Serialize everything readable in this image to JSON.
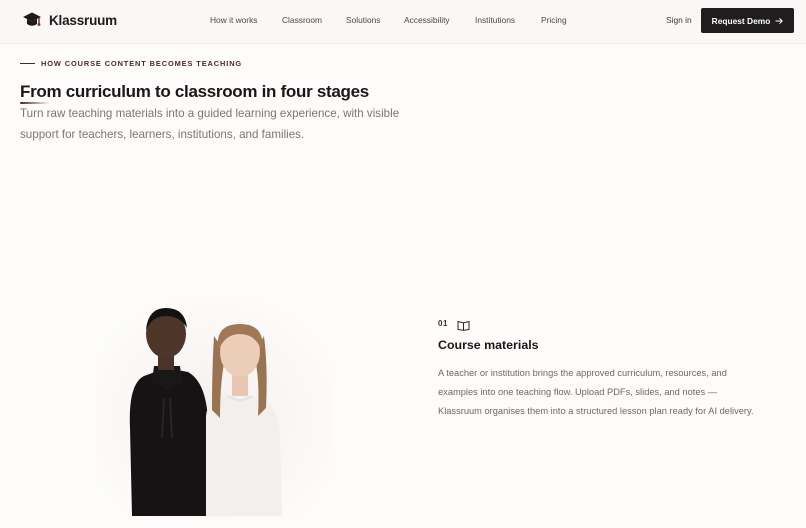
{
  "header": {
    "brand": "Klassruum",
    "nav": [
      "How it works",
      "Classroom",
      "Solutions",
      "Accessibility",
      "Institutions",
      "Pricing"
    ],
    "signin": "Sign in",
    "cta": "Request Demo",
    "cta_icon": "arrow-right-icon"
  },
  "hero": {
    "eyebrow": "HOW COURSE CONTENT BECOMES TEACHING",
    "title": "From curriculum to classroom in four stages",
    "subtitle": "Turn raw teaching materials into a guided learning experience, with visible support for teachers, learners, institutions, and families."
  },
  "step": {
    "number": "01",
    "icon": "book-icon",
    "title": "Course materials",
    "description": "A teacher or institution brings the approved curriculum, resources, and examples into one teaching flow. Upload PDFs, slides, and notes — Klassruum organises them into a structured lesson plan ready for AI delivery."
  },
  "colors": {
    "accent": "#5a1e2a",
    "button_bg": "#1f1d1e",
    "background": "#fdfcfb"
  }
}
